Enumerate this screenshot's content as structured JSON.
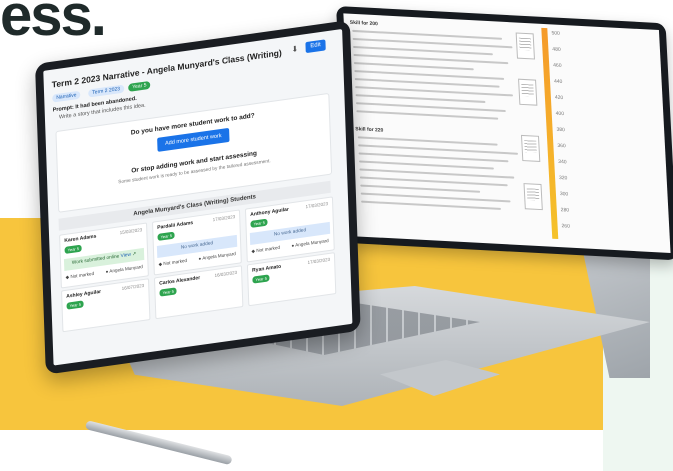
{
  "hero": {
    "fragment": "ess."
  },
  "colors": {
    "accent": "#1a73e8",
    "success": "#2ea44f",
    "band": "#f7c53d"
  },
  "app": {
    "title": "Term 2 2023 Narrative - Angela Munyard's Class (Writing)",
    "edit_label": "Edit",
    "edit_icon": "pencil-icon",
    "download_icon": "download-icon",
    "tags": [
      "Narrative",
      "Term 2 2023",
      "Year 5"
    ],
    "prompt_label": "Prompt: It had been abandoned.",
    "prompt_text": "Write a story that includes this idea.",
    "upload_question": "Do you have more student work to add?",
    "add_button": "Add more student work",
    "assess_question": "Or stop adding work and start assessing",
    "assess_subtitle": "Some student work is ready to be assessed by the tailored assessment.",
    "class_header": "Angela Munyard's Class (Writing) Students",
    "students": [
      {
        "name": "Karen Adams",
        "date": "15/03/2023",
        "badge": "Year 5",
        "status": "Work submitted online",
        "status_link": "View",
        "foot_left": "Not marked",
        "foot_right": "Angela Munyard"
      },
      {
        "name": "Pardalii Adams",
        "date": "17/03/2023",
        "badge": "Year 5",
        "status": "No work added",
        "foot_left": "Not marked",
        "foot_right": "Angela Munyard"
      },
      {
        "name": "Anthony Aguilar",
        "date": "17/03/2023",
        "badge": "Year 5",
        "status": "No work added",
        "foot_left": "Not marked",
        "foot_right": "Angela Munyard"
      },
      {
        "name": "Ashley Aguilar",
        "date": "16/07/2023",
        "badge": "Year 5"
      },
      {
        "name": "Carlos Alexander",
        "date": "16/03/2023",
        "badge": "Year 5"
      },
      {
        "name": "Ryan Amato",
        "date": "17/03/2023",
        "badge": "Year 5"
      }
    ]
  },
  "tablet": {
    "sections": [
      "Skill for 200",
      "Skill for 220"
    ],
    "scale": [
      "500",
      "480",
      "460",
      "440",
      "420",
      "400",
      "380",
      "360",
      "340",
      "320",
      "300",
      "280",
      "260"
    ]
  }
}
